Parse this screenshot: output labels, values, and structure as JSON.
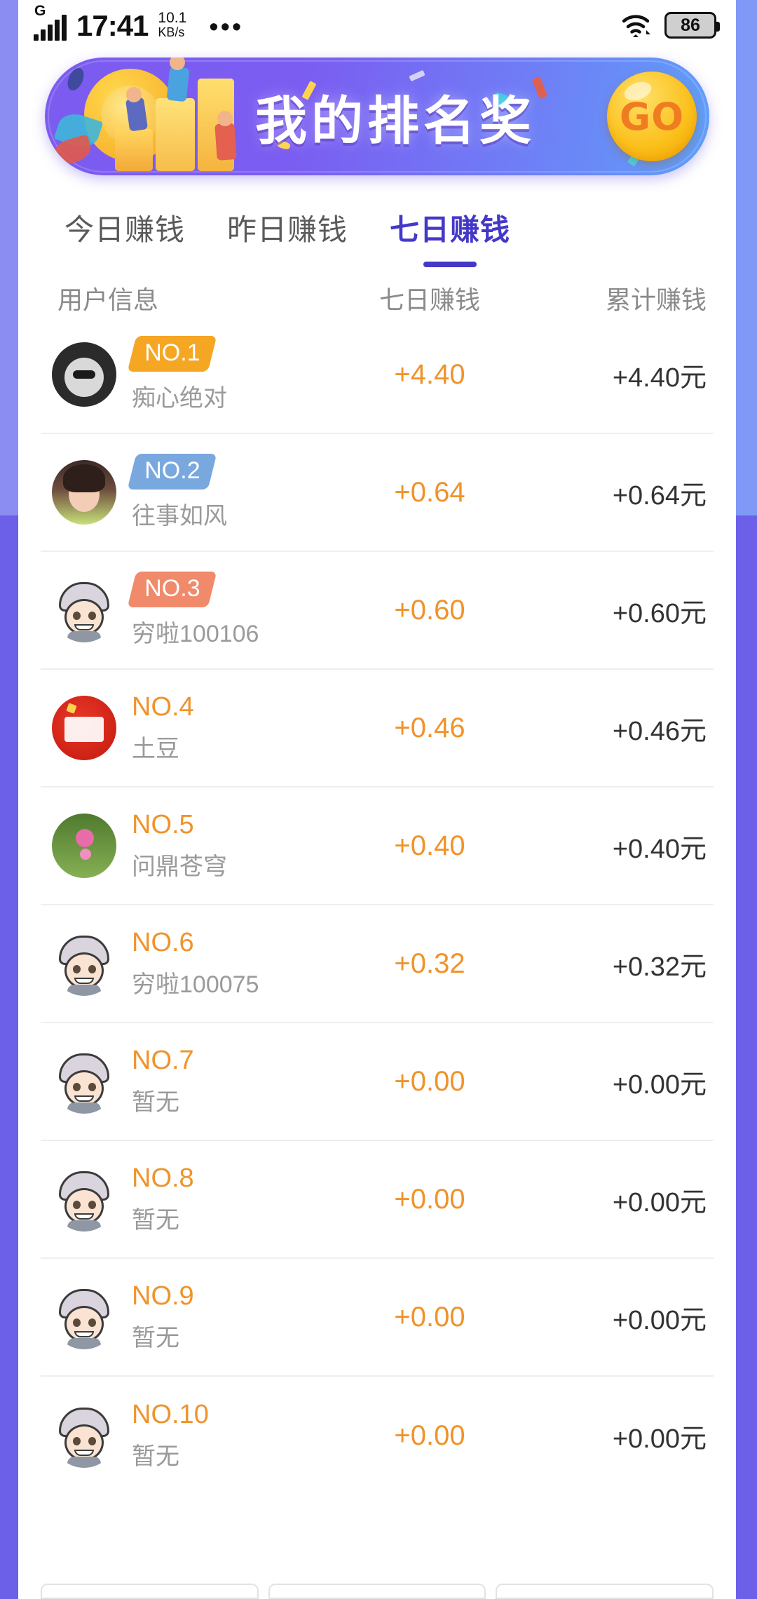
{
  "status_bar": {
    "network_type": "G",
    "time": "17:41",
    "net_speed_value": "10.1",
    "net_speed_unit": "KB/s",
    "overflow_icon": "more-horizontal-icon",
    "wifi_icon": "wifi-icon",
    "battery_level": "86"
  },
  "banner": {
    "title": "我的排名奖",
    "go_label": "GO"
  },
  "tabs": [
    {
      "label": "今日赚钱",
      "active": false
    },
    {
      "label": "昨日赚钱",
      "active": false
    },
    {
      "label": "七日赚钱",
      "active": true
    }
  ],
  "table": {
    "headers": {
      "user": "用户信息",
      "period": "七日赚钱",
      "total": "累计赚钱"
    },
    "rows": [
      {
        "rank": "NO.1",
        "badge": true,
        "badge_color": "#f5a623",
        "name": "痴心绝对",
        "period": "+4.40",
        "total": "+4.40元",
        "avatar": "av-joker"
      },
      {
        "rank": "NO.2",
        "badge": true,
        "badge_color": "#79a8de",
        "name": "往事如风",
        "period": "+0.64",
        "total": "+0.64元",
        "avatar": "av-girl"
      },
      {
        "rank": "NO.3",
        "badge": true,
        "badge_color": "#f08a6a",
        "name": "穷啦100106",
        "period": "+0.60",
        "total": "+0.60元",
        "avatar": "av-boy"
      },
      {
        "rank": "NO.4",
        "badge": false,
        "badge_color": "",
        "name": "土豆",
        "period": "+0.46",
        "total": "+0.46元",
        "avatar": "av-flag"
      },
      {
        "rank": "NO.5",
        "badge": false,
        "badge_color": "",
        "name": "问鼎苍穹",
        "period": "+0.40",
        "total": "+0.40元",
        "avatar": "av-flower"
      },
      {
        "rank": "NO.6",
        "badge": false,
        "badge_color": "",
        "name": "穷啦100075",
        "period": "+0.32",
        "total": "+0.32元",
        "avatar": "av-boy"
      },
      {
        "rank": "NO.7",
        "badge": false,
        "badge_color": "",
        "name": "暂无",
        "period": "+0.00",
        "total": "+0.00元",
        "avatar": "av-boy"
      },
      {
        "rank": "NO.8",
        "badge": false,
        "badge_color": "",
        "name": "暂无",
        "period": "+0.00",
        "total": "+0.00元",
        "avatar": "av-boy"
      },
      {
        "rank": "NO.9",
        "badge": false,
        "badge_color": "",
        "name": "暂无",
        "period": "+0.00",
        "total": "+0.00元",
        "avatar": "av-boy"
      },
      {
        "rank": "NO.10",
        "badge": false,
        "badge_color": "",
        "name": "暂无",
        "period": "+0.00",
        "total": "+0.00元",
        "avatar": "av-boy"
      }
    ]
  },
  "colors": {
    "accent_purple": "#4438c8",
    "page_purple": "#6c5fe8",
    "page_blue": "#8099f7",
    "amount_orange": "#f0932b"
  }
}
